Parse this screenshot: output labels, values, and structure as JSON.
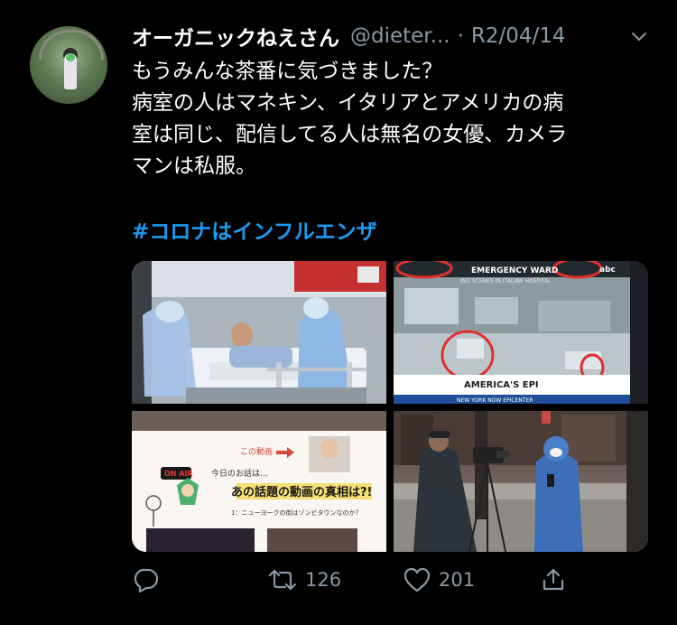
{
  "tweet": {
    "display_name": "オーガニックねえさん",
    "handle": "@dieter...",
    "separator": "·",
    "date": "R2/04/14",
    "text_lines": [
      "もうみんな茶番に気づきました？",
      "病室の人はマネキン、イタリアとアメリカの病",
      "室は同じ、配信してる人は無名の女優、カメラ",
      "マンは私服。"
    ],
    "hashtag": "#コロナはインフルエンザ",
    "images": {
      "image1": {
        "caption": ""
      },
      "image2": {
        "banner_top": "EMERGENCY WARD",
        "banner_sub": "ING SCENES IN ITALIAN HOSPITAL",
        "network": "abc",
        "footer": "AMERICA'S EPI",
        "footer_small": "NEW YORK NOW EPICENTER"
      },
      "image3": {
        "this_video": "この動画",
        "on_air": "ON AIR",
        "today_topic": "今日のお話は…",
        "headline": "あの話題の動画の真相は?!",
        "subline": "1：ニューヨークの街はゾンビタウンなのか？"
      },
      "image4": {
        "caption": ""
      }
    },
    "actions": {
      "reply_count": "",
      "retweet_count": "126",
      "like_count": "201"
    }
  },
  "colors": {
    "background": "#000000",
    "text": "#ffffff",
    "muted": "#8b98a5",
    "accent": "#1d9bf0"
  },
  "icons": {
    "reply": "speech-bubble-icon",
    "retweet": "retweet-icon",
    "like": "heart-icon",
    "share": "share-icon",
    "more": "chevron-down-icon"
  }
}
